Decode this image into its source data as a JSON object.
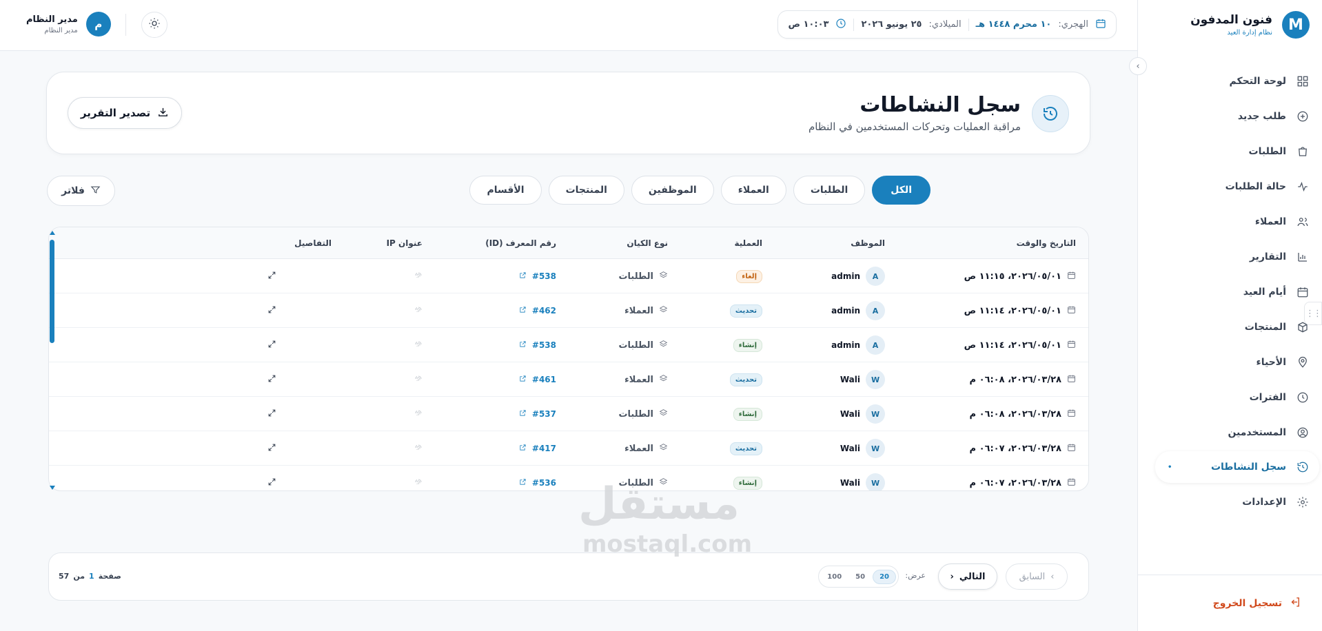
{
  "brand": {
    "logo_letter": "M",
    "title": "فنون المدفون",
    "subtitle": "نظام إدارة العيد"
  },
  "sidebar": {
    "items": [
      {
        "label": "لوحة التحكم",
        "icon": "dashboard-icon"
      },
      {
        "label": "طلب جديد",
        "icon": "plus-circle-icon"
      },
      {
        "label": "الطلبات",
        "icon": "bag-icon"
      },
      {
        "label": "حالة الطلبات",
        "icon": "activity-icon"
      },
      {
        "label": "العملاء",
        "icon": "users-icon"
      },
      {
        "label": "التقارير",
        "icon": "bar-chart-icon"
      },
      {
        "label": "أيام العيد",
        "icon": "calendar-icon"
      },
      {
        "label": "المنتجات",
        "icon": "box-icon"
      },
      {
        "label": "الأحياء",
        "icon": "map-pin-icon"
      },
      {
        "label": "الفترات",
        "icon": "clock-icon"
      },
      {
        "label": "المستخدمين",
        "icon": "user-circle-icon"
      },
      {
        "label": "سجل النشاطات",
        "icon": "history-icon",
        "active": true
      },
      {
        "label": "الإعدادات",
        "icon": "gear-icon"
      }
    ],
    "logout_label": "تسجيل الخروج"
  },
  "topbar": {
    "hijri_label": "الهجري:",
    "hijri_value": "١٠ محرم ١٤٤٨ هـ",
    "gregorian_label": "الميلادي:",
    "gregorian_value": "٢٥ يونيو ٢٠٢٦",
    "time_value": "١٠:٠٣ ص",
    "user_name": "مدير النظام",
    "user_role": "مدير النظام",
    "user_avatar_letter": "م"
  },
  "header": {
    "title": "سجل النشاطات",
    "subtitle": "مراقبة العمليات وتحركات المستخدمين في النظام",
    "export_label": "تصدير التقرير"
  },
  "tabs": [
    "الكل",
    "الطلبات",
    "العملاء",
    "الموظفين",
    "المنتجات",
    "الأقسام"
  ],
  "filter_label": "فلاتر",
  "table": {
    "columns": [
      "التاريخ والوقت",
      "الموظف",
      "العملية",
      "نوع الكيان",
      "رقم المعرف (ID)",
      "عنوان IP",
      "التفاصيل"
    ],
    "rows": [
      {
        "datetime": "٢٠٢٦/٠٥/٠١، ١١:١٥ ص",
        "employee": "admin",
        "initial": "A",
        "action": "إلغاء",
        "action_type": "cancel",
        "entity": "الطلبات",
        "id": "#538"
      },
      {
        "datetime": "٢٠٢٦/٠٥/٠١، ١١:١٤ ص",
        "employee": "admin",
        "initial": "A",
        "action": "تحديث",
        "action_type": "update",
        "entity": "العملاء",
        "id": "#462"
      },
      {
        "datetime": "٢٠٢٦/٠٥/٠١، ١١:١٤ ص",
        "employee": "admin",
        "initial": "A",
        "action": "إنشاء",
        "action_type": "create",
        "entity": "الطلبات",
        "id": "#538"
      },
      {
        "datetime": "٢٠٢٦/٠٣/٢٨، ٠٦:٠٨ م",
        "employee": "Wali",
        "initial": "W",
        "action": "تحديث",
        "action_type": "update",
        "entity": "العملاء",
        "id": "#461"
      },
      {
        "datetime": "٢٠٢٦/٠٣/٢٨، ٠٦:٠٨ م",
        "employee": "Wali",
        "initial": "W",
        "action": "إنشاء",
        "action_type": "create",
        "entity": "الطلبات",
        "id": "#537"
      },
      {
        "datetime": "٢٠٢٦/٠٣/٢٨، ٠٦:٠٧ م",
        "employee": "Wali",
        "initial": "W",
        "action": "تحديث",
        "action_type": "update",
        "entity": "العملاء",
        "id": "#417"
      },
      {
        "datetime": "٢٠٢٦/٠٣/٢٨، ٠٦:٠٧ م",
        "employee": "Wali",
        "initial": "W",
        "action": "إنشاء",
        "action_type": "create",
        "entity": "الطلبات",
        "id": "#536"
      }
    ]
  },
  "pagination": {
    "prev_label": "السابق",
    "next_label": "التالي",
    "show_label": "عرض:",
    "page_sizes": [
      "20",
      "50",
      "100"
    ],
    "active_size": "20",
    "page_label": "صفحة",
    "current_page": "1",
    "of_label": "من",
    "total": "57"
  },
  "watermark": {
    "line1": "مستقل",
    "line2": "mostaql.com"
  },
  "colors": {
    "accent": "#1a80bd",
    "danger": "#d14a1d"
  }
}
